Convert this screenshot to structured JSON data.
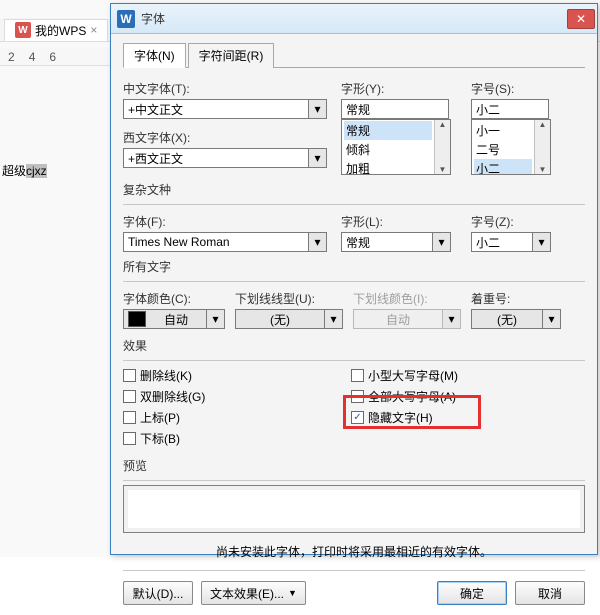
{
  "bg": {
    "tab_label": "我的WPS",
    "ruler": [
      "2",
      "4",
      "6"
    ],
    "doc_plain": "超级",
    "doc_selected": "cjxz"
  },
  "dialog": {
    "title": "字体",
    "tabs": {
      "font": "字体(N)",
      "spacing": "字符间距(R)"
    },
    "section_cn": {
      "label": "中文字体(T):",
      "value": "+中文正文"
    },
    "section_west": {
      "label": "西文字体(X):",
      "value": "+西文正文"
    },
    "style": {
      "label": "字形(Y):",
      "value": "常规",
      "options": [
        "常规",
        "倾斜",
        "加粗"
      ]
    },
    "size": {
      "label": "字号(S):",
      "value": "小二",
      "options": [
        "小一",
        "二号",
        "小二"
      ]
    },
    "complex": {
      "group": "复杂文种",
      "font_label": "字体(F):",
      "font_value": "Times New Roman",
      "style_label": "字形(L):",
      "style_value": "常规",
      "size_label": "字号(Z):",
      "size_value": "小二"
    },
    "all_text": {
      "group": "所有文字",
      "color_label": "字体颜色(C):",
      "color_value": "自动",
      "under_style_label": "下划线线型(U):",
      "under_style_value": "(无)",
      "under_color_label": "下划线颜色(I):",
      "under_color_value": "自动",
      "emphasis_label": "着重号:",
      "emphasis_value": "(无)"
    },
    "effects": {
      "group": "效果",
      "strike": "删除线(K)",
      "dstrike": "双删除线(G)",
      "superscript": "上标(P)",
      "subscript": "下标(B)",
      "smallcaps": "小型大写字母(M)",
      "allcaps": "全部大写字母(A)",
      "hidden": "隐藏文字(H)"
    },
    "preview": {
      "group": "预览",
      "note": "尚未安装此字体，打印时将采用最相近的有效字体。"
    },
    "footer": {
      "default": "默认(D)...",
      "text_effects": "文本效果(E)...",
      "ok": "确定",
      "cancel": "取消"
    }
  }
}
